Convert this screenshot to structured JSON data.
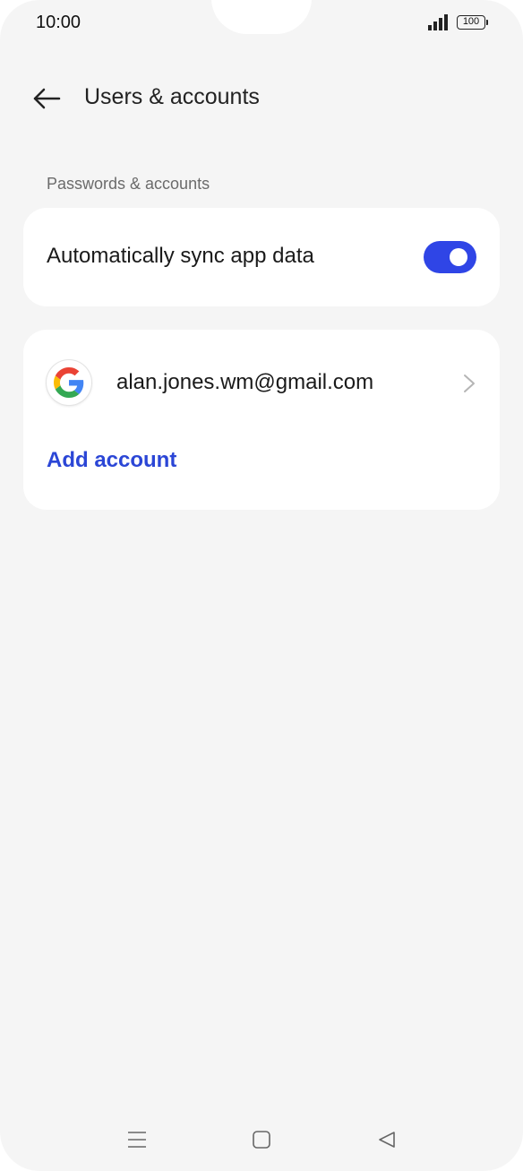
{
  "status_bar": {
    "time": "10:00",
    "battery": "100"
  },
  "header": {
    "title": "Users & accounts"
  },
  "section": {
    "label": "Passwords & accounts"
  },
  "sync": {
    "label": "Automatically sync app data",
    "enabled": true
  },
  "accounts": {
    "items": [
      {
        "email": "alan.jones.wm@gmail.com",
        "provider_icon": "google-icon"
      }
    ],
    "add_label": "Add account"
  },
  "colors": {
    "accent": "#2f45e6",
    "link": "#2b46d6",
    "background": "#f5f5f5",
    "card": "#ffffff"
  }
}
